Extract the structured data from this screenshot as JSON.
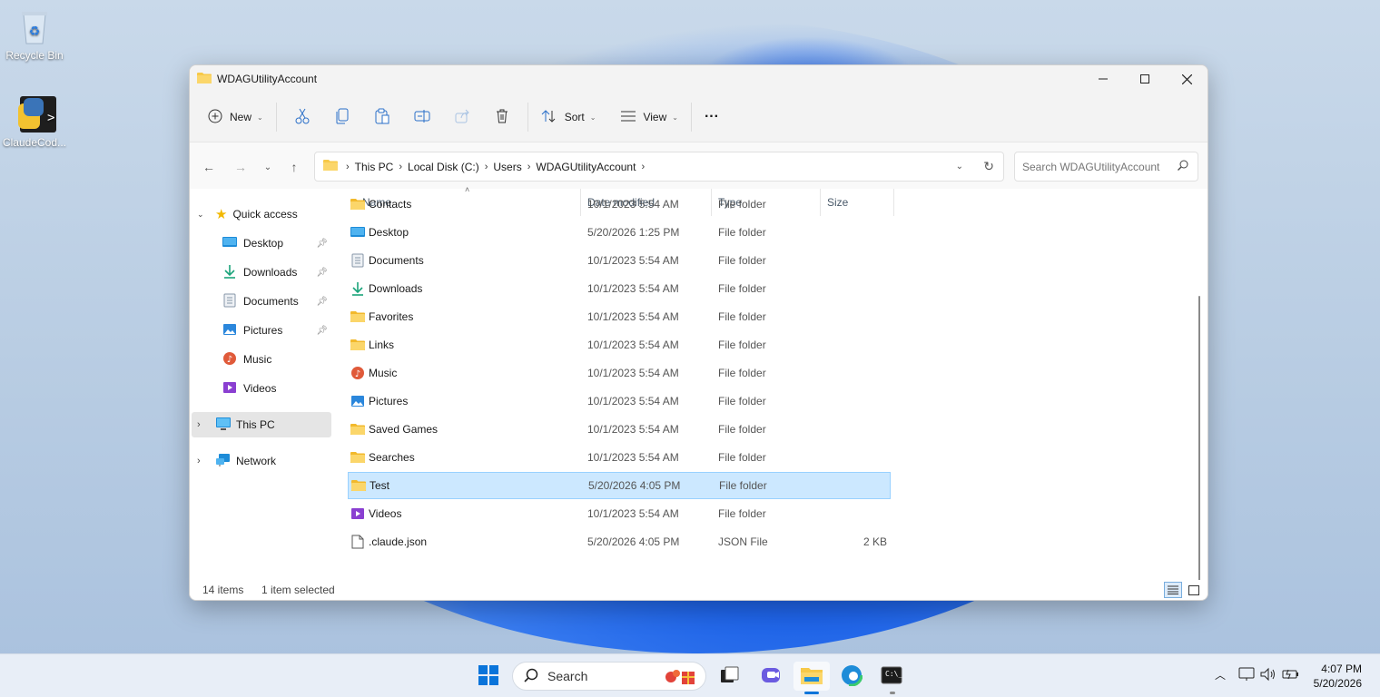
{
  "desktop": {
    "icons": [
      {
        "label": "Recycle Bin"
      },
      {
        "label": "ClaudeCod..."
      }
    ]
  },
  "window": {
    "title": "WDAGUtilityAccount",
    "controls": {
      "minimize": "minimize",
      "maximize": "maximize",
      "close": "close"
    }
  },
  "toolbar": {
    "new_label": "New",
    "sort_label": "Sort",
    "view_label": "View",
    "more_label": "···"
  },
  "address": {
    "crumbs": [
      "This PC",
      "Local Disk (C:)",
      "Users",
      "WDAGUtilityAccount"
    ],
    "search_placeholder": "Search WDAGUtilityAccount"
  },
  "nav": {
    "quick_access": "Quick access",
    "items": [
      {
        "label": "Desktop",
        "icon": "desktop-icon",
        "pinned": true
      },
      {
        "label": "Downloads",
        "icon": "downloads-icon",
        "pinned": true
      },
      {
        "label": "Documents",
        "icon": "documents-icon",
        "pinned": true
      },
      {
        "label": "Pictures",
        "icon": "pictures-icon",
        "pinned": true
      },
      {
        "label": "Music",
        "icon": "music-icon",
        "pinned": false
      },
      {
        "label": "Videos",
        "icon": "videos-icon",
        "pinned": false
      }
    ],
    "this_pc": "This PC",
    "network": "Network"
  },
  "columns": {
    "name": "Name",
    "date": "Date modified",
    "type": "Type",
    "size": "Size"
  },
  "files": [
    {
      "name": "Contacts",
      "date": "10/1/2023 5:54 AM",
      "type": "File folder",
      "size": "",
      "icon": "folder"
    },
    {
      "name": "Desktop",
      "date": "5/20/2026 1:25 PM",
      "type": "File folder",
      "size": "",
      "icon": "desktop"
    },
    {
      "name": "Documents",
      "date": "10/1/2023 5:54 AM",
      "type": "File folder",
      "size": "",
      "icon": "documents"
    },
    {
      "name": "Downloads",
      "date": "10/1/2023 5:54 AM",
      "type": "File folder",
      "size": "",
      "icon": "downloads"
    },
    {
      "name": "Favorites",
      "date": "10/1/2023 5:54 AM",
      "type": "File folder",
      "size": "",
      "icon": "folder"
    },
    {
      "name": "Links",
      "date": "10/1/2023 5:54 AM",
      "type": "File folder",
      "size": "",
      "icon": "folder"
    },
    {
      "name": "Music",
      "date": "10/1/2023 5:54 AM",
      "type": "File folder",
      "size": "",
      "icon": "music"
    },
    {
      "name": "Pictures",
      "date": "10/1/2023 5:54 AM",
      "type": "File folder",
      "size": "",
      "icon": "pictures"
    },
    {
      "name": "Saved Games",
      "date": "10/1/2023 5:54 AM",
      "type": "File folder",
      "size": "",
      "icon": "folder"
    },
    {
      "name": "Searches",
      "date": "10/1/2023 5:54 AM",
      "type": "File folder",
      "size": "",
      "icon": "folder"
    },
    {
      "name": "Test",
      "date": "5/20/2026 4:05 PM",
      "type": "File folder",
      "size": "",
      "icon": "folder",
      "selected": true
    },
    {
      "name": "Videos",
      "date": "10/1/2023 5:54 AM",
      "type": "File folder",
      "size": "",
      "icon": "videos"
    },
    {
      "name": ".claude.json",
      "date": "5/20/2026 4:05 PM",
      "type": "JSON File",
      "size": "2 KB",
      "icon": "file"
    }
  ],
  "status": {
    "count": "14 items",
    "selected": "1 item selected"
  },
  "taskbar": {
    "search_label": "Search",
    "time": "4:07 PM",
    "date": "5/20/2026"
  },
  "colors": {
    "highlight_border": "#c8412e",
    "selection_bg": "#cce8ff",
    "folder": "#f7c948"
  }
}
